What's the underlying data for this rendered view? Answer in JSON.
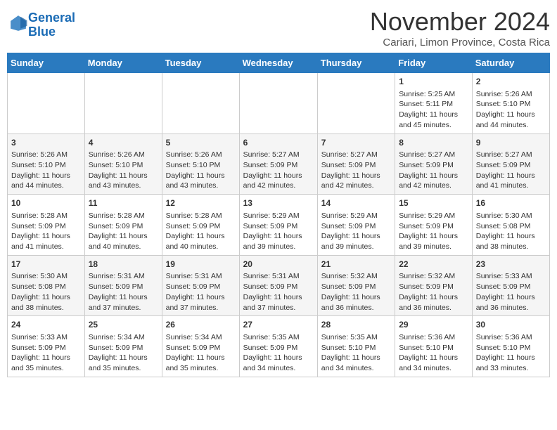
{
  "header": {
    "logo_line1": "General",
    "logo_line2": "Blue",
    "month_title": "November 2024",
    "location": "Cariari, Limon Province, Costa Rica"
  },
  "columns": [
    "Sunday",
    "Monday",
    "Tuesday",
    "Wednesday",
    "Thursday",
    "Friday",
    "Saturday"
  ],
  "rows": [
    [
      {
        "day": "",
        "info": ""
      },
      {
        "day": "",
        "info": ""
      },
      {
        "day": "",
        "info": ""
      },
      {
        "day": "",
        "info": ""
      },
      {
        "day": "",
        "info": ""
      },
      {
        "day": "1",
        "info": "Sunrise: 5:25 AM\nSunset: 5:11 PM\nDaylight: 11 hours and 45 minutes."
      },
      {
        "day": "2",
        "info": "Sunrise: 5:26 AM\nSunset: 5:10 PM\nDaylight: 11 hours and 44 minutes."
      }
    ],
    [
      {
        "day": "3",
        "info": "Sunrise: 5:26 AM\nSunset: 5:10 PM\nDaylight: 11 hours and 44 minutes."
      },
      {
        "day": "4",
        "info": "Sunrise: 5:26 AM\nSunset: 5:10 PM\nDaylight: 11 hours and 43 minutes."
      },
      {
        "day": "5",
        "info": "Sunrise: 5:26 AM\nSunset: 5:10 PM\nDaylight: 11 hours and 43 minutes."
      },
      {
        "day": "6",
        "info": "Sunrise: 5:27 AM\nSunset: 5:09 PM\nDaylight: 11 hours and 42 minutes."
      },
      {
        "day": "7",
        "info": "Sunrise: 5:27 AM\nSunset: 5:09 PM\nDaylight: 11 hours and 42 minutes."
      },
      {
        "day": "8",
        "info": "Sunrise: 5:27 AM\nSunset: 5:09 PM\nDaylight: 11 hours and 42 minutes."
      },
      {
        "day": "9",
        "info": "Sunrise: 5:27 AM\nSunset: 5:09 PM\nDaylight: 11 hours and 41 minutes."
      }
    ],
    [
      {
        "day": "10",
        "info": "Sunrise: 5:28 AM\nSunset: 5:09 PM\nDaylight: 11 hours and 41 minutes."
      },
      {
        "day": "11",
        "info": "Sunrise: 5:28 AM\nSunset: 5:09 PM\nDaylight: 11 hours and 40 minutes."
      },
      {
        "day": "12",
        "info": "Sunrise: 5:28 AM\nSunset: 5:09 PM\nDaylight: 11 hours and 40 minutes."
      },
      {
        "day": "13",
        "info": "Sunrise: 5:29 AM\nSunset: 5:09 PM\nDaylight: 11 hours and 39 minutes."
      },
      {
        "day": "14",
        "info": "Sunrise: 5:29 AM\nSunset: 5:09 PM\nDaylight: 11 hours and 39 minutes."
      },
      {
        "day": "15",
        "info": "Sunrise: 5:29 AM\nSunset: 5:09 PM\nDaylight: 11 hours and 39 minutes."
      },
      {
        "day": "16",
        "info": "Sunrise: 5:30 AM\nSunset: 5:08 PM\nDaylight: 11 hours and 38 minutes."
      }
    ],
    [
      {
        "day": "17",
        "info": "Sunrise: 5:30 AM\nSunset: 5:08 PM\nDaylight: 11 hours and 38 minutes."
      },
      {
        "day": "18",
        "info": "Sunrise: 5:31 AM\nSunset: 5:09 PM\nDaylight: 11 hours and 37 minutes."
      },
      {
        "day": "19",
        "info": "Sunrise: 5:31 AM\nSunset: 5:09 PM\nDaylight: 11 hours and 37 minutes."
      },
      {
        "day": "20",
        "info": "Sunrise: 5:31 AM\nSunset: 5:09 PM\nDaylight: 11 hours and 37 minutes."
      },
      {
        "day": "21",
        "info": "Sunrise: 5:32 AM\nSunset: 5:09 PM\nDaylight: 11 hours and 36 minutes."
      },
      {
        "day": "22",
        "info": "Sunrise: 5:32 AM\nSunset: 5:09 PM\nDaylight: 11 hours and 36 minutes."
      },
      {
        "day": "23",
        "info": "Sunrise: 5:33 AM\nSunset: 5:09 PM\nDaylight: 11 hours and 36 minutes."
      }
    ],
    [
      {
        "day": "24",
        "info": "Sunrise: 5:33 AM\nSunset: 5:09 PM\nDaylight: 11 hours and 35 minutes."
      },
      {
        "day": "25",
        "info": "Sunrise: 5:34 AM\nSunset: 5:09 PM\nDaylight: 11 hours and 35 minutes."
      },
      {
        "day": "26",
        "info": "Sunrise: 5:34 AM\nSunset: 5:09 PM\nDaylight: 11 hours and 35 minutes."
      },
      {
        "day": "27",
        "info": "Sunrise: 5:35 AM\nSunset: 5:09 PM\nDaylight: 11 hours and 34 minutes."
      },
      {
        "day": "28",
        "info": "Sunrise: 5:35 AM\nSunset: 5:10 PM\nDaylight: 11 hours and 34 minutes."
      },
      {
        "day": "29",
        "info": "Sunrise: 5:36 AM\nSunset: 5:10 PM\nDaylight: 11 hours and 34 minutes."
      },
      {
        "day": "30",
        "info": "Sunrise: 5:36 AM\nSunset: 5:10 PM\nDaylight: 11 hours and 33 minutes."
      }
    ]
  ]
}
